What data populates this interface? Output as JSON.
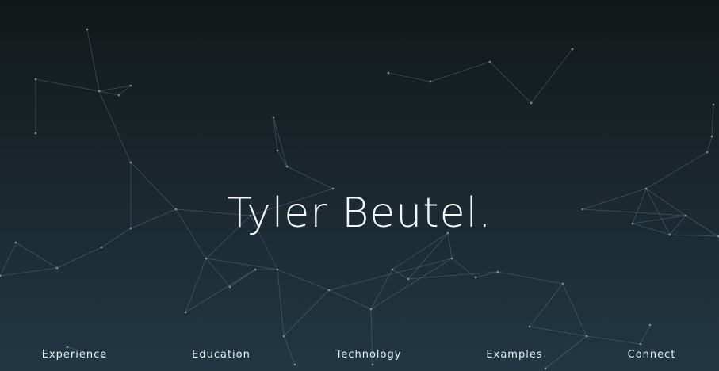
{
  "hero": {
    "title": "Tyler Beutel."
  },
  "nav": {
    "items": [
      {
        "label": "Experience"
      },
      {
        "label": "Education"
      },
      {
        "label": "Technology"
      },
      {
        "label": "Examples"
      },
      {
        "label": "Connect"
      }
    ]
  },
  "colors": {
    "background_top": "#121819",
    "background_bottom": "#213743",
    "network_line": "#5f7e8c",
    "text": "#f4f7f8"
  }
}
